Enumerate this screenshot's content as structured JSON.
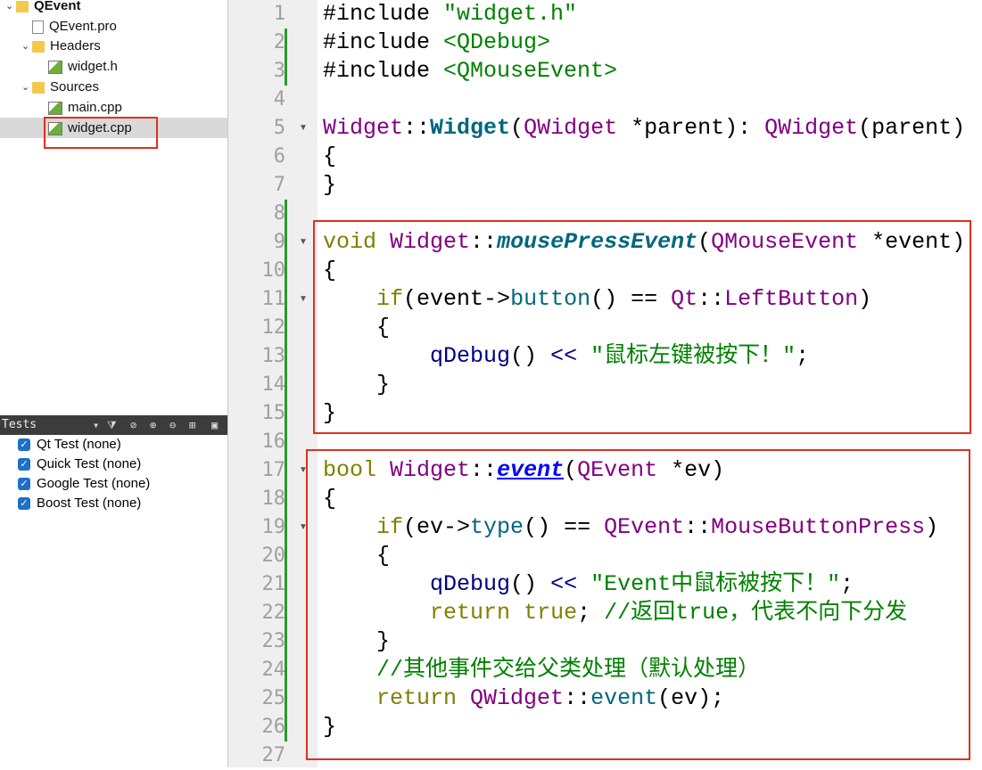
{
  "project_tree": {
    "items": [
      {
        "label": "QEvent",
        "icon": "qt-project-folder-icon",
        "level": 0,
        "expanded": true,
        "bold": true
      },
      {
        "label": "QEvent.pro",
        "icon": "pro-file-icon",
        "level": 1
      },
      {
        "label": "Headers",
        "icon": "headers-folder-icon",
        "level": 1,
        "expanded": true
      },
      {
        "label": "widget.h",
        "icon": "header-file-icon",
        "level": 2
      },
      {
        "label": "Sources",
        "icon": "sources-folder-icon",
        "level": 1,
        "expanded": true
      },
      {
        "label": "main.cpp",
        "icon": "cpp-file-icon",
        "level": 2
      },
      {
        "label": "widget.cpp",
        "icon": "cpp-file-icon",
        "level": 2,
        "selected": true
      }
    ]
  },
  "tests_panel": {
    "title": "Tests",
    "items": [
      {
        "label": "Qt Test (none)",
        "checked": true
      },
      {
        "label": "Quick Test (none)",
        "checked": true
      },
      {
        "label": "Google Test (none)",
        "checked": true
      },
      {
        "label": "Boost Test (none)",
        "checked": true
      }
    ]
  },
  "editor": {
    "lines": [
      {
        "n": "1",
        "tokens": [
          [
            "#include ",
            ""
          ],
          [
            "\"widget.h\"",
            "st"
          ]
        ]
      },
      {
        "n": "2",
        "changed": true,
        "tokens": [
          [
            "#include ",
            ""
          ],
          [
            "<QDebug>",
            "st"
          ]
        ]
      },
      {
        "n": "3",
        "changed": true,
        "tokens": [
          [
            "#include ",
            ""
          ],
          [
            "<QMouseEvent>",
            "st"
          ]
        ]
      },
      {
        "n": "4",
        "tokens": []
      },
      {
        "n": "5",
        "fold": true,
        "tokens": [
          [
            "Widget",
            "ty"
          ],
          [
            "::",
            ""
          ],
          [
            "Widget",
            "fn"
          ],
          [
            "(",
            ""
          ],
          [
            "QWidget",
            "ty"
          ],
          [
            " *parent): ",
            ""
          ],
          [
            "QWidget",
            "ty"
          ],
          [
            "(parent)",
            ""
          ]
        ]
      },
      {
        "n": "6",
        "tokens": [
          [
            "{",
            ""
          ]
        ]
      },
      {
        "n": "7",
        "tokens": [
          [
            "}",
            ""
          ]
        ]
      },
      {
        "n": "8",
        "changed": true,
        "tokens": []
      },
      {
        "n": "9",
        "changed": true,
        "fold": true,
        "tokens": [
          [
            "void",
            "kw"
          ],
          [
            " ",
            ""
          ],
          [
            "Widget",
            "ty"
          ],
          [
            "::",
            ""
          ],
          [
            "mousePressEvent",
            "fi"
          ],
          [
            "(",
            ""
          ],
          [
            "QMouseEvent",
            "ty"
          ],
          [
            " *event)",
            ""
          ]
        ]
      },
      {
        "n": "10",
        "changed": true,
        "tokens": [
          [
            "{",
            ""
          ]
        ]
      },
      {
        "n": "11",
        "changed": true,
        "fold": true,
        "tokens": [
          [
            "    ",
            ""
          ],
          [
            "if",
            "kw"
          ],
          [
            "(event->",
            ""
          ],
          [
            "button",
            "cl"
          ],
          [
            "() == ",
            ""
          ],
          [
            "Qt",
            "ty"
          ],
          [
            "::",
            ""
          ],
          [
            "LeftButton",
            "ty"
          ],
          [
            ")",
            ""
          ]
        ]
      },
      {
        "n": "12",
        "changed": true,
        "tokens": [
          [
            "    {",
            ""
          ]
        ]
      },
      {
        "n": "13",
        "changed": true,
        "tokens": [
          [
            "        ",
            ""
          ],
          [
            "qDebug",
            "db"
          ],
          [
            "() ",
            ""
          ],
          [
            "<<",
            "op"
          ],
          [
            " ",
            ""
          ],
          [
            "\"鼠标左键被按下！\"",
            "st"
          ],
          [
            ";",
            ""
          ]
        ]
      },
      {
        "n": "14",
        "changed": true,
        "tokens": [
          [
            "    }",
            ""
          ]
        ]
      },
      {
        "n": "15",
        "changed": true,
        "tokens": [
          [
            "}",
            ""
          ]
        ]
      },
      {
        "n": "16",
        "changed": true,
        "tokens": []
      },
      {
        "n": "17",
        "changed": true,
        "fold": true,
        "tokens": [
          [
            "bool",
            "kw"
          ],
          [
            " ",
            ""
          ],
          [
            "Widget",
            "ty"
          ],
          [
            "::",
            ""
          ],
          [
            "event",
            "fu"
          ],
          [
            "(",
            ""
          ],
          [
            "QEvent",
            "ty"
          ],
          [
            " *ev)",
            ""
          ]
        ]
      },
      {
        "n": "18",
        "changed": true,
        "tokens": [
          [
            "{",
            ""
          ]
        ]
      },
      {
        "n": "19",
        "changed": true,
        "fold": true,
        "tokens": [
          [
            "    ",
            ""
          ],
          [
            "if",
            "kw"
          ],
          [
            "(ev->",
            ""
          ],
          [
            "type",
            "cl"
          ],
          [
            "() == ",
            ""
          ],
          [
            "QEvent",
            "ty"
          ],
          [
            "::",
            ""
          ],
          [
            "MouseButtonPress",
            "ty"
          ],
          [
            ")",
            ""
          ]
        ]
      },
      {
        "n": "20",
        "changed": true,
        "tokens": [
          [
            "    {",
            ""
          ]
        ]
      },
      {
        "n": "21",
        "changed": true,
        "tokens": [
          [
            "        ",
            ""
          ],
          [
            "qDebug",
            "db"
          ],
          [
            "() ",
            ""
          ],
          [
            "<<",
            "op"
          ],
          [
            " ",
            ""
          ],
          [
            "\"Event中鼠标被按下！\"",
            "st"
          ],
          [
            ";",
            ""
          ]
        ]
      },
      {
        "n": "22",
        "changed": true,
        "tokens": [
          [
            "        ",
            ""
          ],
          [
            "return",
            "kw"
          ],
          [
            " ",
            ""
          ],
          [
            "true",
            "kw"
          ],
          [
            "; ",
            ""
          ],
          [
            "//返回true，代表不向下分发",
            "cm"
          ]
        ]
      },
      {
        "n": "23",
        "changed": true,
        "tokens": [
          [
            "    }",
            ""
          ]
        ]
      },
      {
        "n": "24",
        "changed": true,
        "tokens": [
          [
            "    ",
            ""
          ],
          [
            "//其他事件交给父类处理（默认处理）",
            "cm"
          ]
        ]
      },
      {
        "n": "25",
        "changed": true,
        "tokens": [
          [
            "    ",
            ""
          ],
          [
            "return",
            "kw"
          ],
          [
            " ",
            ""
          ],
          [
            "QWidget",
            "ty"
          ],
          [
            "::",
            ""
          ],
          [
            "event",
            "cl"
          ],
          [
            "(ev);",
            ""
          ]
        ]
      },
      {
        "n": "26",
        "changed": true,
        "tokens": [
          [
            "}",
            ""
          ]
        ]
      },
      {
        "n": "27",
        "tokens": []
      }
    ]
  },
  "colors": {
    "highlight_box": "#e0301e",
    "change_bar": "#2a9a2a"
  }
}
